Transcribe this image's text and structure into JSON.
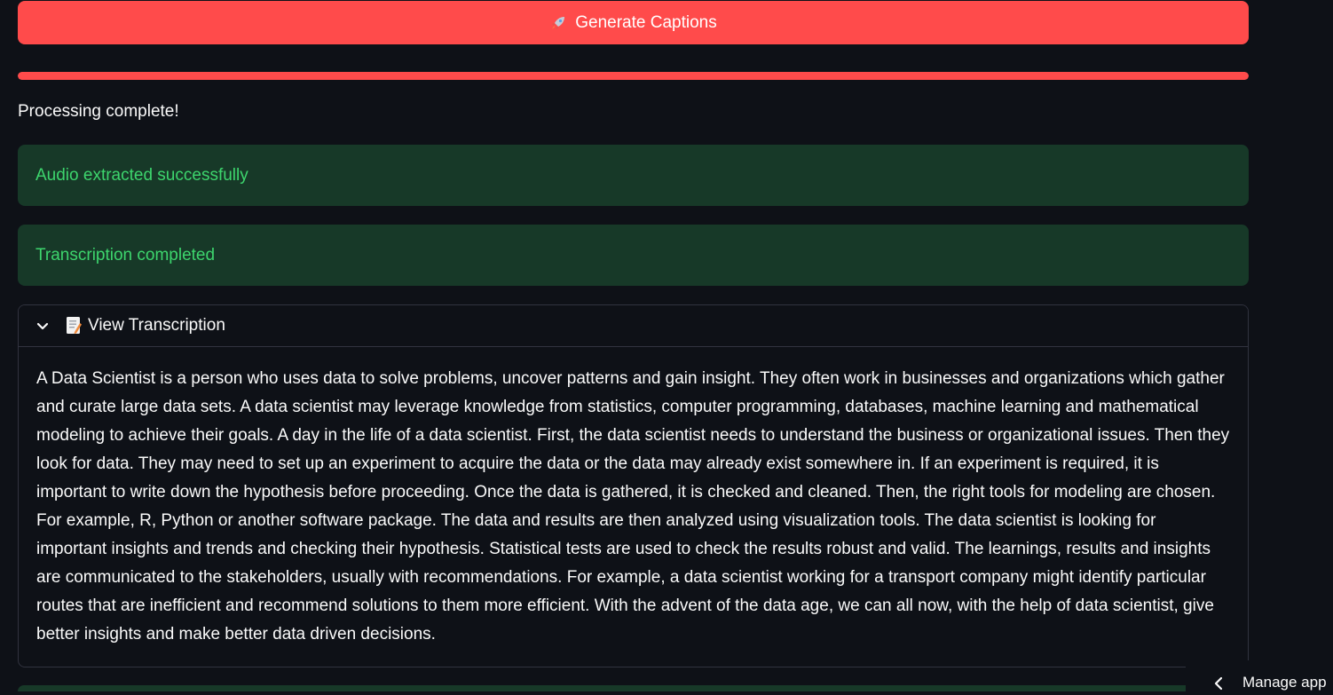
{
  "generate_button": {
    "icon": "rocket-icon",
    "label": "Generate Captions",
    "color": "#ff4b4b"
  },
  "progress": {
    "value": 1.0
  },
  "status_text": "Processing complete!",
  "alerts": [
    {
      "type": "success",
      "text": "Audio extracted successfully"
    },
    {
      "type": "success",
      "text": "Transcription completed"
    }
  ],
  "expander": {
    "icon": "memo-icon",
    "title": "View Transcription",
    "expanded": true,
    "body": "A Data Scientist is a person who uses data to solve problems, uncover patterns and gain insight. They often work in businesses and organizations which gather and curate large data sets. A data scientist may leverage knowledge from statistics, computer programming, databases, machine learning and mathematical modeling to achieve their goals. A day in the life of a data scientist. First, the data scientist needs to understand the business or organizational issues. Then they look for data. They may need to set up an experiment to acquire the data or the data may already exist somewhere in. If an experiment is required, it is important to write down the hypothesis before proceeding. Once the data is gathered, it is checked and cleaned. Then, the right tools for modeling are chosen. For example, R, Python or another software package. The data and results are then analyzed using visualization tools. The data scientist is looking for important insights and trends and checking their hypothesis. Statistical tests are used to check the results robust and valid. The learnings, results and insights are communicated to the stakeholders, usually with recommendations. For example, a data scientist working for a transport company might identify particular routes that are inefficient and recommend solutions to them more efficient. With the advent of the data age, we can all now, with the help of data scientist, give better insights and make better data driven decisions."
  },
  "manage_app": {
    "label": "Manage app"
  },
  "colors": {
    "background": "#0e1117",
    "accent": "#ff4b4b",
    "success_bg": "#173928",
    "success_text": "#3dd56d"
  }
}
